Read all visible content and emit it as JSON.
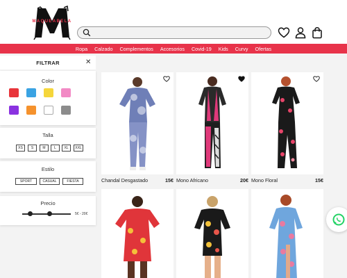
{
  "header": {
    "logo_text": "MAQUEABELA",
    "search_placeholder": "",
    "icons": [
      "heart-icon",
      "user-icon",
      "bag-icon"
    ]
  },
  "nav": {
    "items": [
      "Ropa",
      "Calzado",
      "Complementos",
      "Accesorios",
      "Covid-19",
      "Kids",
      "Curvy",
      "Ofertas"
    ]
  },
  "filters": {
    "title": "FILTRAR",
    "color": {
      "title": "Color",
      "swatches": [
        "#e8353b",
        "#3aa3e3",
        "#f5d63b",
        "#f28ac5",
        "#8a32e0",
        "#f5922d",
        "#ffffff",
        "#8c8c8c"
      ]
    },
    "talla": {
      "title": "Talla",
      "options": [
        "XS",
        "S",
        "M",
        "L",
        "XL",
        "XXL"
      ]
    },
    "estilo": {
      "title": "Estilo",
      "options": [
        "SPORT",
        "CASUAL",
        "FIESTA"
      ]
    },
    "precio": {
      "title": "Precio",
      "range": "5€ - 20€"
    }
  },
  "products": [
    {
      "name": "Chandal Desgastado",
      "price": "15€",
      "favorited": false
    },
    {
      "name": "Mono Africano",
      "price": "20€",
      "favorited": true
    },
    {
      "name": "Mono Floral",
      "price": "15€",
      "favorited": false
    },
    {
      "name": "",
      "price": "",
      "favorited": false
    },
    {
      "name": "",
      "price": "",
      "favorited": false
    },
    {
      "name": "",
      "price": "",
      "favorited": false
    }
  ],
  "colors": {
    "accent": "#e8334a",
    "whatsapp": "#25d366"
  }
}
